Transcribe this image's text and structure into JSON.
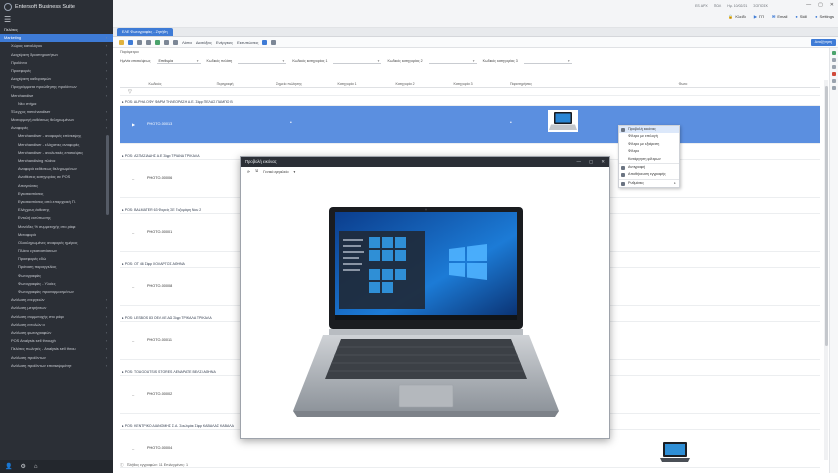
{
  "app": {
    "title": "Entersoft Business Suite",
    "window_controls": [
      "—",
      "▢",
      "✕"
    ]
  },
  "sidebar": {
    "items": [
      {
        "label": "Πελάτες",
        "kind": "top"
      },
      {
        "label": "Marketing",
        "kind": "active"
      },
      {
        "label": "Χώρος καταλόγου",
        "kind": "item"
      },
      {
        "label": "Διαχείριση δραστηριοτήτων",
        "kind": "item"
      },
      {
        "label": "Προϊόντα",
        "kind": "item"
      },
      {
        "label": "Προσφορές",
        "kind": "item"
      },
      {
        "label": "Διαχείριση καθορισμών",
        "kind": "item"
      },
      {
        "label": "Προγράμματα προώθησης προϊόντων",
        "kind": "item"
      },
      {
        "label": "Merchandise",
        "kind": "item"
      },
      {
        "label": "Νέο στήμα",
        "kind": "sub"
      },
      {
        "label": "Έλεγχος merchandiser",
        "kind": "item"
      },
      {
        "label": "Μεσαρμογή εκθέσεως θεληρωμένων",
        "kind": "item"
      },
      {
        "label": "Αναφορές",
        "kind": "item"
      },
      {
        "label": "Merchandiser - αναφορές επίσκεψης",
        "kind": "sub"
      },
      {
        "label": "Merchandiser - ελάχιστες αναφορές",
        "kind": "sub"
      },
      {
        "label": "Merchandiser - αναλυτικές επισκέψεις",
        "kind": "sub"
      },
      {
        "label": "Merchandising πλάνα",
        "kind": "sub"
      },
      {
        "label": "Αναφορά εκθέσεως θεληρωμένων",
        "kind": "sub"
      },
      {
        "label": "Αναθέσεις κατηγορίας σε POS",
        "kind": "sub"
      },
      {
        "label": "Απογεύσεις",
        "kind": "sub"
      },
      {
        "label": "Εγκαταστάσεις",
        "kind": "sub"
      },
      {
        "label": "Εγκαταστάσεις από επαρχιακή Π.",
        "kind": "sub"
      },
      {
        "label": "Ελέγχους έκθεσης",
        "kind": "sub"
      },
      {
        "label": "Εντολή εκτύπωσης",
        "kind": "sub"
      },
      {
        "label": "Μονάδες % συμμετοχής στο ράφι",
        "kind": "sub"
      },
      {
        "label": "Μεταφορά",
        "kind": "sub"
      },
      {
        "label": "Ολοκληρωμένες αναφορές ημέρας",
        "kind": "sub"
      },
      {
        "label": "Πλάνο εγκαταστάσεων",
        "kind": "sub"
      },
      {
        "label": "Προσφορές εδώ",
        "kind": "sub"
      },
      {
        "label": "Πρόταση παραγγελίας",
        "kind": "sub"
      },
      {
        "label": "Φωτογραφίες",
        "kind": "sub"
      },
      {
        "label": "Φωτογραφίες - Υλοίες",
        "kind": "sub"
      },
      {
        "label": "Φωτογραφίες προσαρμοσμένων",
        "kind": "sub"
      },
      {
        "label": "Ανάλυση ενεργειών",
        "kind": "item"
      },
      {
        "label": "Ανάλυση μετρήσεων",
        "kind": "item"
      },
      {
        "label": "Ανάλυση συμμετοχής στο ράφι",
        "kind": "item"
      },
      {
        "label": "Ανάλυση εντολών α",
        "kind": "item"
      },
      {
        "label": "Ανάλυση φωτογραφιών",
        "kind": "item"
      },
      {
        "label": "POS Analysis sell through",
        "kind": "item"
      },
      {
        "label": "Πελάτες πωλητές - Analysis sell throu",
        "kind": "item"
      },
      {
        "label": "Ανάλυση προϊόντων",
        "kind": "item"
      },
      {
        "label": "Ανάλυση προϊόντων επισκεψιμότητ",
        "kind": "item"
      }
    ],
    "footer_icons": [
      "user-icon",
      "gear-icon",
      "home-icon"
    ]
  },
  "topbar": {
    "status": [
      "ES ΑΡΧ",
      "ΠΩΛ",
      "Ημ. 10/02/21",
      "ΣΟΠΟΣΚ"
    ],
    "actions": [
      "Κλείδι",
      "ΓΠ",
      "Email",
      "Skill",
      "Settings"
    ]
  },
  "tab": {
    "label": "ΕΛΕ Φωτογραφίες - Ζητήθη"
  },
  "toolbar": {
    "items": [
      "Λίστα",
      "Διατάξεις",
      "Ενέργειες",
      "Εκτυπώσεις"
    ],
    "right_button": "Αναζήτηση"
  },
  "parameters": {
    "label": "Παράμετροι",
    "filters": [
      {
        "label": "Ημ/νία επισκέψεως",
        "value": "Επιθυμία"
      },
      {
        "label": "Κωδικός πελάτη",
        "value": ""
      },
      {
        "label": "Κωδικός κατηγορίας 1",
        "value": ""
      },
      {
        "label": "Κωδικός κατηγορίας 2",
        "value": ""
      },
      {
        "label": "Κωδικός κατηγορίας 3",
        "value": ""
      }
    ]
  },
  "grid": {
    "columns": [
      "Κωδικός",
      "Περιγραφή",
      "Σημείο πώλησης",
      "Κατηγορία 1",
      "Κατηγορία 2",
      "Κατηγορία 3",
      "Παρατηρήσεις",
      "Φωτο"
    ],
    "filter_icon": "filter-icon",
    "groups": [
      {
        "title": "▸ POS: ALPHA ΟΦΥ ΦΑΡΜ ΤΗΛΕΟΡΑΣΗ Α.Ε. Σίφρ ΠΕΛΑΣ ΠΑΜΠΟ Β",
        "code": "PHOTO-00013",
        "selected": true
      },
      {
        "title": "▸ POS: ΑΣΠΑΣΙΑΔΗΣ Α.Ε Σίφρ ΤΡΙΑΝΑ ΤΡΙΚΑΛΑ",
        "code": "PHOTO-00006",
        "selected": false
      },
      {
        "title": "▸ POS: BALMATER 63 Φορείς ΣΕ Γαζομάρη Νου 2",
        "code": "PHOTO-00001",
        "selected": false
      },
      {
        "title": "▸ POS: OT 46 Σίφρ ΧΟΛΑΡΓΟΣ ΑΘΗΝΑ",
        "code": "PHOTO-00008",
        "selected": false
      },
      {
        "title": "▸ POS: LESBOS 83 ΟΕΛ ΛΕ ΔΩ Σίφρ ΤΡΙΚΑΛΑ ΤΡΙΚΑΛΑ",
        "code": "PHOTO-00011",
        "selected": false
      },
      {
        "title": "▸ POS: TOUGOUTSIS STORES ΛΕΝΑΡΑΤΕ ΒΕΛΣΙ ΑΘΗΝΑ",
        "code": "PHOTO-00002",
        "selected": false
      },
      {
        "title": "▸ POS: ΚΕΝΤΡΙΚΟ ΔΙΑΝΟΜΗΣ Σ.Α. Σουλιμάκ Σίφρ ΚΑΒΑΛΑΣ ΚΑΒΑΛΑ",
        "code": "PHOTO-00004",
        "selected": false
      }
    ]
  },
  "context_menu": {
    "items": [
      {
        "label": "Προβολή εικόνας",
        "highlight": true,
        "arrow": false
      },
      {
        "label": "Φίλτρο με επιλογή",
        "highlight": false,
        "arrow": false
      },
      {
        "label": "Φίλτρο με εξαίρεση",
        "highlight": false,
        "arrow": false
      },
      {
        "label": "Φίλτρο",
        "highlight": false,
        "arrow": false
      },
      {
        "label": "Κατάργηση φίλτρων",
        "highlight": false,
        "arrow": false
      },
      {
        "label": "Αντιγραφή",
        "highlight": false,
        "arrow": false
      },
      {
        "label": "Αποθήκευση εγγραφής",
        "highlight": false,
        "arrow": false
      },
      {
        "label": "Ρυθμίσεις",
        "highlight": false,
        "arrow": true
      }
    ]
  },
  "dialog": {
    "title": "Προβολή εικόνας",
    "tools": [
      "Γενικό εργαλείο"
    ],
    "image_alt": "laptop-photo"
  },
  "statusbar": {
    "text": "Πλήθος εγγραφών: 11 Επιλεγμένες: 1"
  },
  "colors": {
    "sidebar_bg": "#2b2f36",
    "accent": "#3e7bd6",
    "selected_row": "#5b8fe0"
  }
}
